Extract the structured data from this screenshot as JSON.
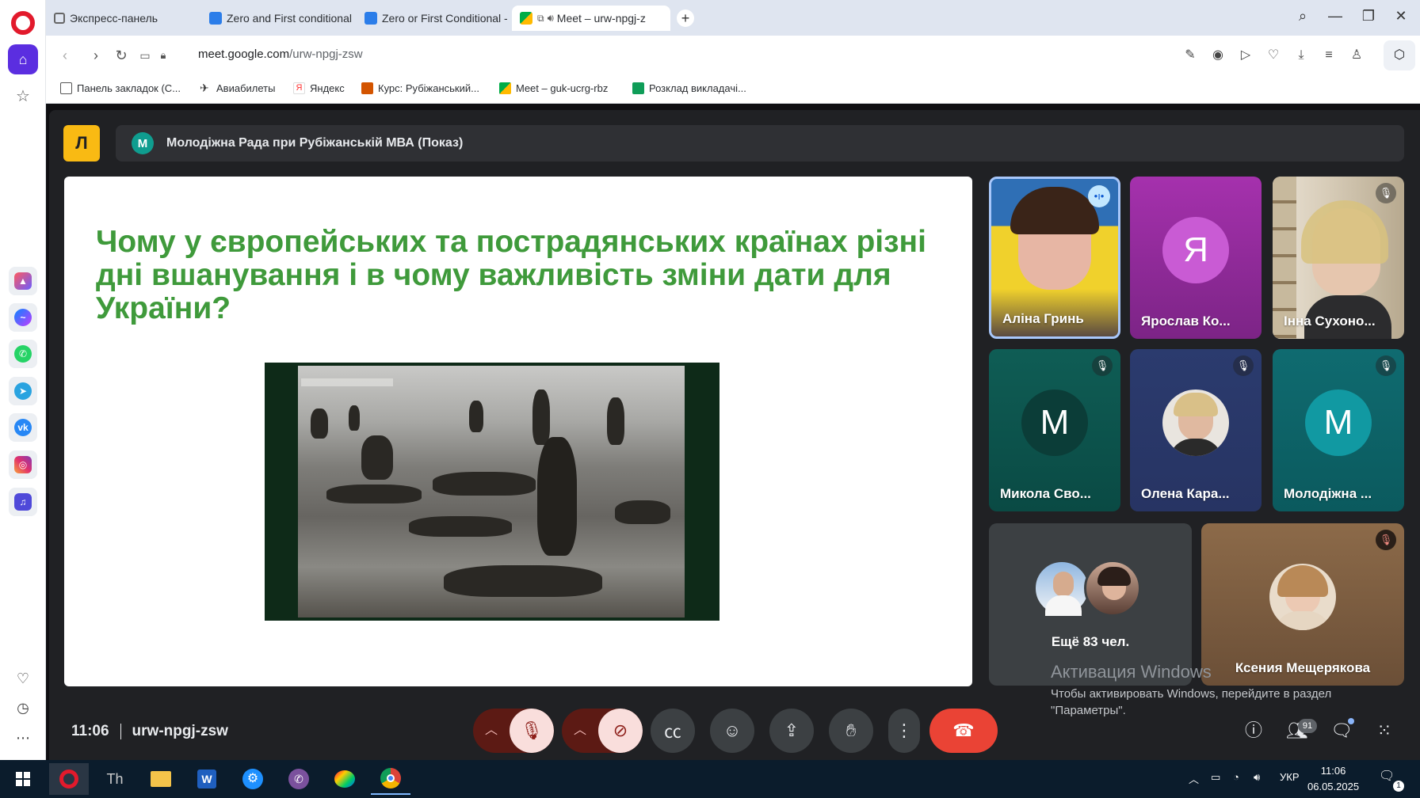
{
  "browser": {
    "tabs": [
      {
        "label": "Экспресс-панель"
      },
      {
        "label": "Zero and First conditional"
      },
      {
        "label": "Zero or First Conditional -"
      },
      {
        "label": "Meet – urw-npgj-z"
      }
    ],
    "url": {
      "host": "meet.google.com",
      "path": "/urw-npgj-zsw"
    },
    "bookmarks": [
      {
        "label": "Панель закладок (С..."
      },
      {
        "label": "Авиабилеты"
      },
      {
        "label": "Яндекс"
      },
      {
        "label": "Курс: Рубіжанський..."
      },
      {
        "label": "Meet – guk-ucrg-rbz"
      },
      {
        "label": "Розклад викладачі..."
      }
    ]
  },
  "meeting": {
    "logo_glyph": "Л",
    "title_avatar": "M",
    "title": "Молодіжна Рада при Рубіжанській МВА (Показ)",
    "slide": {
      "title": "Чому у європейських та пострадянських країнах різні дні вшанування і в чому важливість зміни дати для України?"
    },
    "participants": [
      {
        "name": "Аліна Гринь",
        "kind": "video",
        "speaking": true
      },
      {
        "name": "Ярослав Ко...",
        "kind": "letter",
        "letter": "Я",
        "color": "#b23fc0",
        "muted": false
      },
      {
        "name": "Інна Сухоно...",
        "kind": "video",
        "muted": true
      },
      {
        "name": "Микола Сво...",
        "kind": "letter",
        "letter": "M",
        "color": "#0b4a43",
        "muted": true
      },
      {
        "name": "Олена Кара...",
        "kind": "photo",
        "muted": true
      },
      {
        "name": "Молодіжна ...",
        "kind": "letter",
        "letter": "M",
        "color": "#0f8c94",
        "muted": true
      },
      {
        "name": "Ещё 83 чел.",
        "kind": "overflow"
      },
      {
        "name": "Ксения Мещерякова",
        "kind": "photo",
        "muted": true
      }
    ],
    "time": "11:06",
    "code": "urw-npgj-zsw",
    "participants_badge": "91"
  },
  "windows_activation": {
    "title": "Активация Windows",
    "line1": "Чтобы активировать Windows, перейдите в раздел",
    "line2": "\"Параметры\"."
  },
  "taskbar": {
    "lang": "УКР",
    "time": "11:06",
    "date": "06.05.2025",
    "notifications": "1"
  },
  "colors": {
    "meet_bg": "#202124",
    "slide_title": "#3f9a3b",
    "end_call": "#ea4335",
    "muted_btn": "#f9dedc",
    "opera_red": "#e21a2c"
  }
}
